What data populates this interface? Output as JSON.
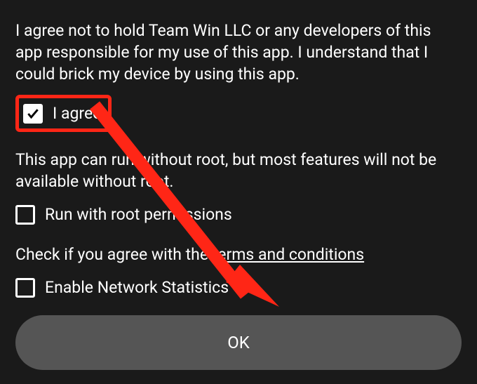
{
  "disclaimer": {
    "liability_text": "I agree not to hold Team Win LLC or any developers of this app responsible for my use of this app. I understand that I could brick my device by using this app.",
    "agree_label": "I agree",
    "root_text": "This app can run without root, but most features will not be available without root.",
    "root_checkbox_label": "Run with root permissions",
    "terms_text_prefix": "Check if you agree with the ",
    "terms_link_text": "terms and conditions",
    "network_checkbox_label": "Enable Network Statistics",
    "ok_button_label": "OK"
  },
  "annotation": {
    "highlight_color": "#ff2616"
  }
}
